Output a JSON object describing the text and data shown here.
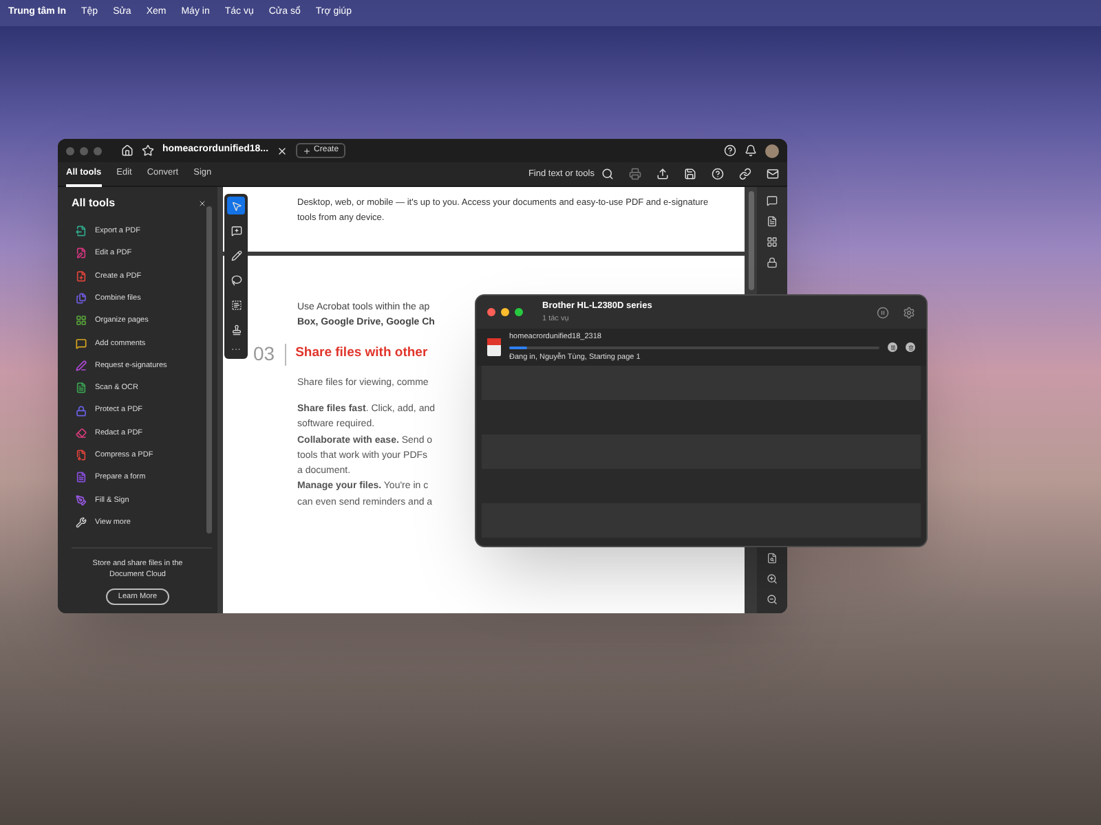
{
  "menu_bar": {
    "items": [
      "Trung tâm In",
      "Tệp",
      "Sửa",
      "Xem",
      "Máy in",
      "Tác vụ",
      "Cửa sổ",
      "Trợ giúp"
    ]
  },
  "acrobat": {
    "tab_title": "homeacrordunified18...",
    "create_button": "Create",
    "mode_tabs": [
      {
        "label": "All tools",
        "selected": true
      },
      {
        "label": "Edit",
        "selected": false
      },
      {
        "label": "Convert",
        "selected": false
      },
      {
        "label": "Sign",
        "selected": false
      }
    ],
    "find_label": "Find text or tools",
    "sidebar": {
      "title": "All tools",
      "tools": [
        {
          "label": "Export a PDF",
          "color": "#2fa88a"
        },
        {
          "label": "Edit a PDF",
          "color": "#d6367f"
        },
        {
          "label": "Create a PDF",
          "color": "#e0443a"
        },
        {
          "label": "Combine files",
          "color": "#6f5ce0"
        },
        {
          "label": "Organize pages",
          "color": "#58a43a"
        },
        {
          "label": "Add comments",
          "color": "#d8a620"
        },
        {
          "label": "Request e-signatures",
          "color": "#b049d6"
        },
        {
          "label": "Scan & OCR",
          "color": "#3aa351"
        },
        {
          "label": "Protect a PDF",
          "color": "#6a62e8"
        },
        {
          "label": "Redact a PDF",
          "color": "#d63b7b"
        },
        {
          "label": "Compress a PDF",
          "color": "#e0433b"
        },
        {
          "label": "Prepare a form",
          "color": "#8a4fe0"
        },
        {
          "label": "Fill & Sign",
          "color": "#9a58e6"
        }
      ],
      "view_more": "View more",
      "promo": "Store and share files in the Document Cloud",
      "learn_more": "Learn More"
    },
    "tool_strip": {
      "tools": [
        {
          "selected": true
        },
        {
          "selected": false
        },
        {
          "selected": false
        },
        {
          "selected": false
        },
        {
          "selected": false
        },
        {
          "selected": false
        }
      ],
      "more": "···"
    },
    "document": {
      "page_1_text": "Desktop, web, or mobile — it's up to you. Access your documents and easy-to-use PDF and e-signature tools from any device.",
      "intro_lines": [
        "Use Acrobat tools within the ap",
        "**Box, Google Drive, Google Ch**"
      ],
      "section_number": "03",
      "section_heading": "Share files with other",
      "section_lines": [
        "Share files for viewing, comme"
      ],
      "detail_lines": [
        "**Share files fast**. Click, add, and",
        "software required.",
        "**Collaborate with ease.** Send o",
        "tools that work with your PDFs",
        "a document.",
        "**Manage your files.** You're in c",
        "can even send reminders and a"
      ]
    }
  },
  "print_queue": {
    "printer": "Brother HL-L2380D series",
    "subtitle": "1 tác vụ",
    "job": {
      "file_name": "homeacrordunified18_2318",
      "level": 0.05,
      "status": "Đang in, Nguyễn Tùng, Starting page 1"
    }
  }
}
